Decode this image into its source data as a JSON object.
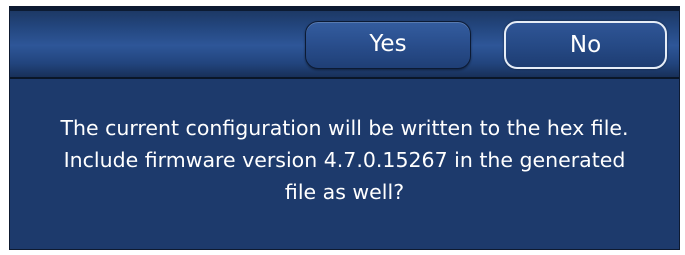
{
  "dialog": {
    "buttons": {
      "yes_label": "Yes",
      "no_label": "No"
    },
    "message_lines": [
      "The current configuration will be written to the hex file.",
      "Include firmware version 4.7.0.15267 in the generated",
      "file as well?"
    ]
  },
  "colors": {
    "dialog_background": "#1d3a6c",
    "button_fill": "#2a4f8e",
    "button_focus_border": "#e6edf7",
    "text": "#ffffff"
  }
}
